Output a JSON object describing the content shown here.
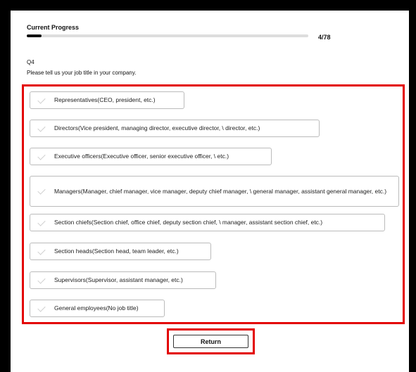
{
  "progress": {
    "label": "Current Progress",
    "current": 4,
    "total": 78,
    "count_text": "4/78"
  },
  "question": {
    "number": "Q4",
    "text": "Please tell us your job title in your company."
  },
  "options": [
    "Representatives(CEO, president, etc.)",
    "Directors(Vice president, managing director, executive director, \\ director, etc.)",
    "Executive officers(Executive officer, senior executive officer, \\ etc.)",
    "Managers(Manager, chief manager, vice manager, deputy chief manager, \\ general manager, assistant general manager, etc.)",
    "Section chiefs(Section chief, office chief, deputy section chief, \\ manager, assistant section chief, etc.)",
    "Section heads(Section head, team leader, etc.)",
    "Supervisors(Supervisor, assistant manager, etc.)",
    "General employees(No job title)"
  ],
  "return_label": "Return",
  "colors": {
    "highlight": "#e30000",
    "progress_fill": "#111111",
    "progress_track": "#dddddd"
  },
  "icons": {
    "option_marker": "checkmark-icon"
  }
}
